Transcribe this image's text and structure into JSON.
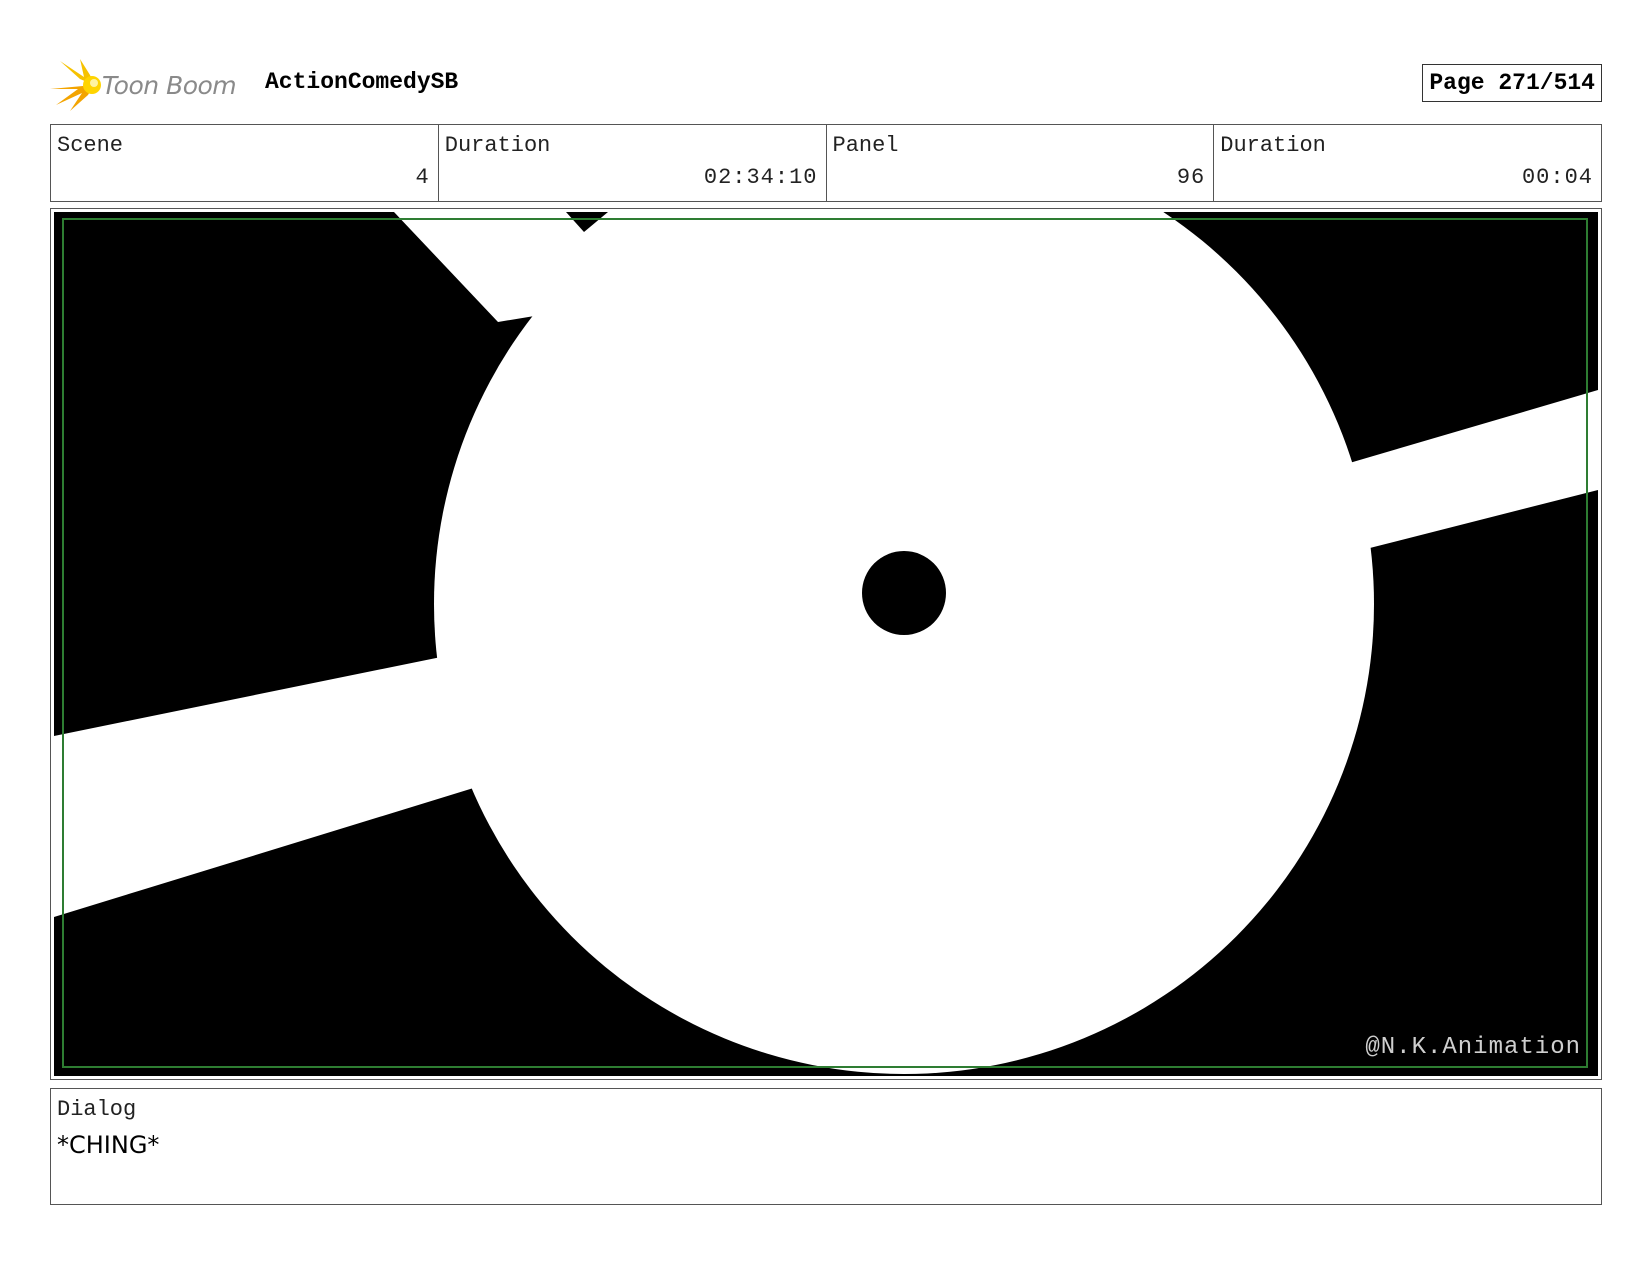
{
  "header": {
    "logo_text": "Toon Boom",
    "project_title": "ActionComedySB",
    "page_label": "Page 271/514"
  },
  "info": {
    "scene_label": "Scene",
    "scene_value": "4",
    "scene_duration_label": "Duration",
    "scene_duration_value": "02:34:10",
    "panel_label": "Panel",
    "panel_value": "96",
    "panel_duration_label": "Duration",
    "panel_duration_value": "00:04"
  },
  "panel": {
    "watermark": "@N.K.Animation",
    "safe_frame_color": "#2e7d32"
  },
  "dialog": {
    "label": "Dialog",
    "text": "*CHING*"
  }
}
